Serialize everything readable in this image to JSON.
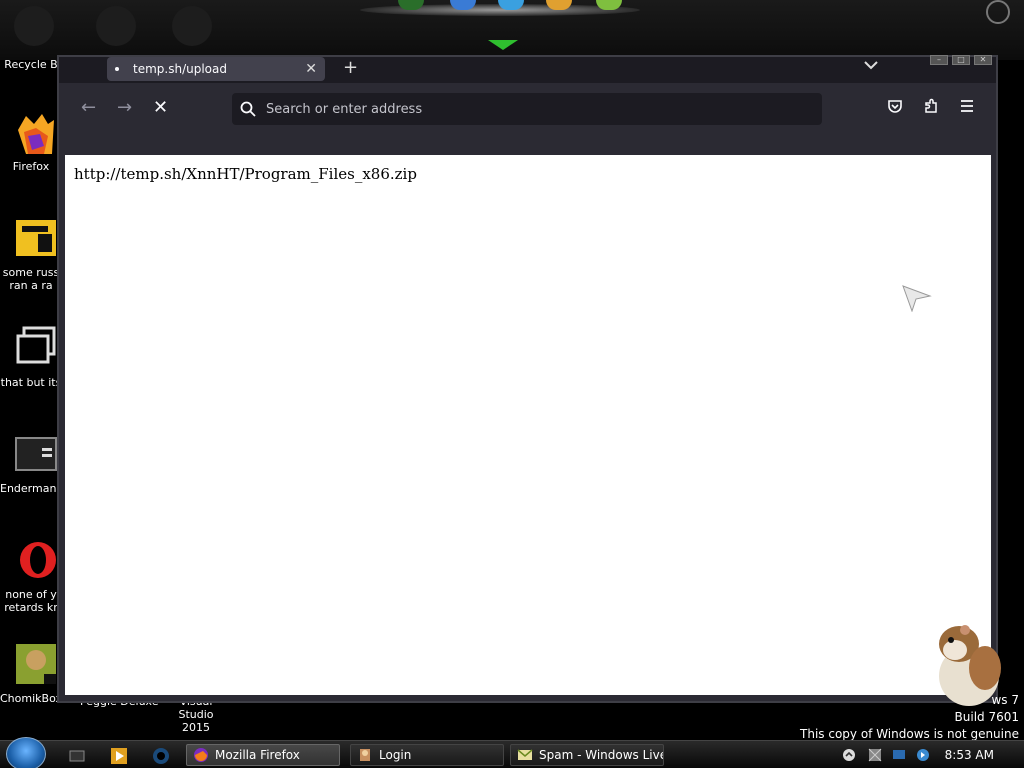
{
  "desktop": {
    "icons": [
      {
        "label": "Recycle B"
      },
      {
        "label": "Firefox"
      },
      {
        "label_line1": "some russ",
        "label_line2": "ran a ra"
      },
      {
        "label": "that but its"
      },
      {
        "label": "Endermanc"
      },
      {
        "label_line1": "none of y",
        "label_line2": "retards kr"
      },
      {
        "label": "ChomikBox"
      }
    ],
    "partial_labels": {
      "peggle": "Peggle Deluxe",
      "vs": "Visual Studio",
      "vs_year": "2015"
    },
    "watermark": {
      "line1": "ws 7",
      "line2": "Build 7601",
      "line3": "This copy of Windows is not genuine"
    }
  },
  "browser": {
    "tab_title": "temp.sh/upload",
    "url_placeholder": "Search or enter address",
    "page_text": "http://temp.sh/XnnHT/Program_Files_x86.zip",
    "icons": [
      "back-icon",
      "forward-icon",
      "stop-icon",
      "search-icon",
      "pocket-icon",
      "extensions-icon",
      "menu-icon"
    ]
  },
  "taskbar": {
    "tasks": [
      {
        "label": "Mozilla Firefox",
        "active": true
      },
      {
        "label": "Login",
        "active": false
      },
      {
        "label": "Spam - Windows Live ...",
        "active": false
      }
    ],
    "clock": "8:53 AM"
  },
  "colors": {
    "firefox_chrome": "#2b2a33",
    "urlbar": "#1c1b22",
    "tab_active": "#42414d"
  }
}
